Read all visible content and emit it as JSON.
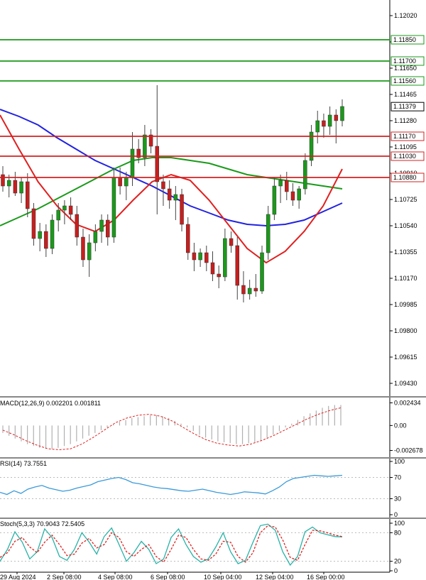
{
  "chart_data": {
    "type": "candlestick",
    "price_axis": {
      "ticks": [
        "1.12020",
        "1.11835",
        "1.11650",
        "1.11465",
        "1.11280",
        "1.11095",
        "1.10910",
        "1.10725",
        "1.10540",
        "1.10355",
        "1.10170",
        "1.09985",
        "1.09800",
        "1.09615",
        "1.09430"
      ],
      "ylim": [
        1.0934,
        1.1213
      ]
    },
    "current_price": {
      "label": "1.11379",
      "value": 1.11379
    },
    "levels": [
      {
        "label": "1.11850",
        "value": 1.1185,
        "color": "#1a9a1a"
      },
      {
        "label": "1.11700",
        "value": 1.117,
        "color": "#1a9a1a"
      },
      {
        "label": "1.11560",
        "value": 1.1156,
        "color": "#1a9a1a"
      },
      {
        "label": "1.11170",
        "value": 1.1117,
        "color": "#d42020"
      },
      {
        "label": "1.11030",
        "value": 1.1103,
        "color": "#d42020"
      },
      {
        "label": "1.10880",
        "value": 1.1088,
        "color": "#d42020"
      }
    ],
    "candles": [
      [
        1.109,
        1.1096,
        1.1078,
        1.1082
      ],
      [
        1.1082,
        1.109,
        1.1074,
        1.1086
      ],
      [
        1.1086,
        1.1092,
        1.1075,
        1.1077
      ],
      [
        1.1077,
        1.1088,
        1.107,
        1.1085
      ],
      [
        1.1085,
        1.1091,
        1.106,
        1.1066
      ],
      [
        1.1066,
        1.107,
        1.104,
        1.1045
      ],
      [
        1.1045,
        1.1056,
        1.1036,
        1.105
      ],
      [
        1.105,
        1.1055,
        1.1032,
        1.1038
      ],
      [
        1.1038,
        1.1062,
        1.1034,
        1.1058
      ],
      [
        1.1058,
        1.107,
        1.105,
        1.1065
      ],
      [
        1.1065,
        1.1072,
        1.1055,
        1.1068
      ],
      [
        1.1068,
        1.1074,
        1.1058,
        1.1062
      ],
      [
        1.1062,
        1.1068,
        1.104,
        1.1046
      ],
      [
        1.1046,
        1.1052,
        1.1025,
        1.103
      ],
      [
        1.103,
        1.1048,
        1.1018,
        1.1042
      ],
      [
        1.1042,
        1.1055,
        1.1036,
        1.105
      ],
      [
        1.105,
        1.1062,
        1.1042,
        1.1058
      ],
      [
        1.1058,
        1.1062,
        1.104,
        1.1046
      ],
      [
        1.1046,
        1.1095,
        1.1042,
        1.1088
      ],
      [
        1.1088,
        1.1095,
        1.1076,
        1.1082
      ],
      [
        1.1082,
        1.1092,
        1.1072,
        1.1088
      ],
      [
        1.1088,
        1.112,
        1.1082,
        1.1108
      ],
      [
        1.1108,
        1.1115,
        1.1098,
        1.1102
      ],
      [
        1.1102,
        1.1125,
        1.1096,
        1.1118
      ],
      [
        1.1118,
        1.1122,
        1.1105,
        1.111
      ],
      [
        1.111,
        1.1153,
        1.1062,
        1.1085
      ],
      [
        1.1085,
        1.109,
        1.1068,
        1.108
      ],
      [
        1.108,
        1.1086,
        1.1066,
        1.1072
      ],
      [
        1.1072,
        1.1082,
        1.1058,
        1.1076
      ],
      [
        1.1076,
        1.108,
        1.105,
        1.1055
      ],
      [
        1.1055,
        1.106,
        1.103,
        1.1035
      ],
      [
        1.1035,
        1.1042,
        1.1022,
        1.103
      ],
      [
        1.103,
        1.1038,
        1.1025,
        1.1035
      ],
      [
        1.1035,
        1.104,
        1.1022,
        1.1028
      ],
      [
        1.1028,
        1.1036,
        1.1015,
        1.102
      ],
      [
        1.102,
        1.1026,
        1.101,
        1.1018
      ],
      [
        1.1018,
        1.1052,
        1.1015,
        1.1045
      ],
      [
        1.1045,
        1.105,
        1.1035,
        1.104
      ],
      [
        1.104,
        1.1046,
        1.1002,
        1.1012
      ],
      [
        1.1012,
        1.1022,
        1.1,
        1.1006
      ],
      [
        1.1006,
        1.1016,
        1.1002,
        1.101
      ],
      [
        1.101,
        1.102,
        1.1004,
        1.1008
      ],
      [
        1.1008,
        1.104,
        1.1006,
        1.1035
      ],
      [
        1.1035,
        1.1068,
        1.103,
        1.1062
      ],
      [
        1.1062,
        1.1088,
        1.1058,
        1.1082
      ],
      [
        1.1082,
        1.109,
        1.107,
        1.1086
      ],
      [
        1.1086,
        1.1092,
        1.1072,
        1.1078
      ],
      [
        1.1078,
        1.1084,
        1.1068,
        1.1072
      ],
      [
        1.1072,
        1.1082,
        1.1066,
        1.108
      ],
      [
        1.108,
        1.1105,
        1.1076,
        1.11
      ],
      [
        1.11,
        1.1125,
        1.1096,
        1.112
      ],
      [
        1.112,
        1.1135,
        1.1112,
        1.1128
      ],
      [
        1.1128,
        1.1133,
        1.1116,
        1.1124
      ],
      [
        1.1124,
        1.1138,
        1.1118,
        1.1132
      ],
      [
        1.1132,
        1.1136,
        1.1112,
        1.1128
      ],
      [
        1.1128,
        1.1143,
        1.1124,
        1.1138
      ]
    ],
    "moving_averages": [
      {
        "color": "#2222e0",
        "values": [
          1.1136,
          1.1131,
          1.1125,
          1.1116,
          1.1108,
          1.11,
          1.1094,
          1.1088,
          1.1082,
          1.1075,
          1.1068,
          1.1063,
          1.1058,
          1.1055,
          1.1054,
          1.1055,
          1.1058,
          1.1064,
          1.107
        ]
      },
      {
        "color": "#1a9a1a",
        "values": [
          1.1054,
          1.106,
          1.1066,
          1.1073,
          1.108,
          1.1087,
          1.1094,
          1.11,
          1.1102,
          1.1102,
          1.11,
          1.1098,
          1.1094,
          1.109,
          1.1088,
          1.1086,
          1.1084,
          1.1082,
          1.108
        ]
      },
      {
        "color": "#e02020",
        "values": [
          1.1132,
          1.1108,
          1.1085,
          1.1068,
          1.1055,
          1.105,
          1.1058,
          1.1072,
          1.1085,
          1.109,
          1.1086,
          1.1072,
          1.1055,
          1.1038,
          1.1028,
          1.1036,
          1.105,
          1.1068,
          1.1094
        ]
      }
    ],
    "macd": {
      "label": "MACD(12,26,9) 0.002201 0.001811",
      "ticks": [
        "0.002434",
        "0.00",
        "-0.002678"
      ],
      "ylim": [
        -0.0034,
        0.003
      ],
      "histogram": [
        -0.0008,
        -0.0011,
        -0.0014,
        -0.0017,
        -0.002,
        -0.0022,
        -0.0024,
        -0.0025,
        -0.0025,
        -0.0024,
        -0.0022,
        -0.002,
        -0.0017,
        -0.0014,
        -0.0011,
        -0.0008,
        -0.0005,
        -0.0002,
        0.0001,
        0.0004,
        0.0006,
        0.0008,
        0.0009,
        0.001,
        0.0011,
        0.0011,
        0.001,
        0.0008,
        0.0005,
        0.0002,
        -0.0002,
        -0.0006,
        -0.001,
        -0.0013,
        -0.0015,
        -0.0017,
        -0.0018,
        -0.0019,
        -0.002,
        -0.002,
        -0.0019,
        -0.0018,
        -0.0016,
        -0.0013,
        -0.001,
        -0.0006,
        -0.0002,
        0.0002,
        0.0006,
        0.001,
        0.0013,
        0.0016,
        0.0019,
        0.0021,
        0.0022,
        0.0022
      ],
      "signal": [
        -0.0005,
        -0.001,
        -0.0016,
        -0.0021,
        -0.0025,
        -0.0026,
        -0.0025,
        -0.002,
        -0.0013,
        -0.0005,
        0.0003,
        0.0008,
        0.0011,
        0.0012,
        0.001,
        0.0005,
        -0.0002,
        -0.0009,
        -0.0015,
        -0.0019,
        -0.0021,
        -0.0022,
        -0.002,
        -0.0016,
        -0.0011,
        -0.0005,
        0.0001,
        0.0007,
        0.0012,
        0.0016,
        0.0019
      ]
    },
    "rsi": {
      "label": "RSI(14) 73.7551",
      "ticks": [
        "100",
        "70",
        "30",
        "0"
      ],
      "ylim": [
        0,
        100
      ],
      "values": [
        42,
        38,
        45,
        40,
        48,
        52,
        55,
        50,
        47,
        44,
        46,
        50,
        53,
        56,
        62,
        65,
        68,
        70,
        66,
        60,
        58,
        55,
        52,
        50,
        49,
        47,
        45,
        44,
        46,
        48,
        45,
        42,
        40,
        38,
        40,
        43,
        42,
        41,
        39,
        45,
        52,
        62,
        68,
        70,
        72,
        74,
        73,
        72,
        73,
        74
      ]
    },
    "stoch": {
      "label": "Stoch(5,3,3) 70.9043 72.5405",
      "ticks": [
        "100",
        "80",
        "20",
        "0"
      ],
      "ylim": [
        0,
        100
      ],
      "main": [
        20,
        45,
        82,
        60,
        25,
        40,
        88,
        70,
        30,
        22,
        45,
        80,
        60,
        35,
        72,
        90,
        55,
        20,
        38,
        62,
        45,
        15,
        25,
        70,
        88,
        55,
        30,
        18,
        25,
        50,
        80,
        40,
        15,
        22,
        60,
        95,
        98,
        85,
        40,
        12,
        30,
        82,
        92,
        80,
        76,
        72,
        71
      ],
      "signal": [
        28,
        38,
        62,
        70,
        50,
        38,
        60,
        75,
        55,
        32,
        35,
        58,
        68,
        48,
        55,
        80,
        70,
        40,
        30,
        45,
        55,
        30,
        18,
        45,
        75,
        70,
        45,
        25,
        22,
        35,
        62,
        60,
        30,
        18,
        38,
        80,
        95,
        92,
        65,
        28,
        22,
        55,
        85,
        84,
        80,
        75,
        72
      ]
    },
    "time_axis": [
      "29 Aug 2024",
      "2 Sep 08:00",
      "4 Sep 08:00",
      "6 Sep 08:00",
      "10 Sep 04:00",
      "12 Sep 04:00",
      "16 Sep 00:00"
    ]
  }
}
